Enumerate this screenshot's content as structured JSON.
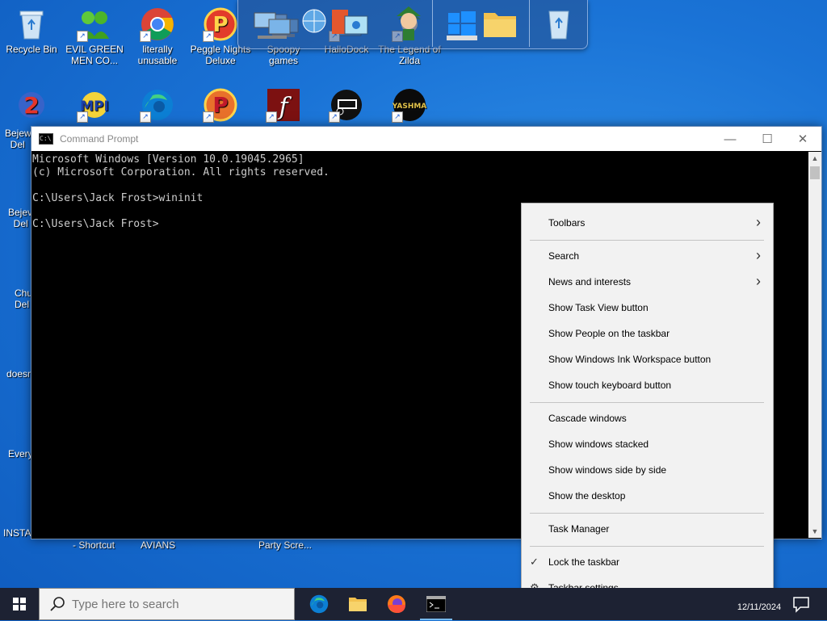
{
  "desktop": {
    "row1": [
      {
        "label": "Recycle Bin",
        "icon": "recycle-bin-icon"
      },
      {
        "label": "EVIL GREEN MEN CO...",
        "icon": "green-men-icon"
      },
      {
        "label": "literally unusable",
        "icon": "chrome-icon"
      },
      {
        "label": "Peggle Nights Deluxe",
        "icon": "peggle-icon"
      },
      {
        "label": "Spoopy games",
        "icon": "computers-icon"
      },
      {
        "label": "HalloDock",
        "icon": "hallodock-icon"
      },
      {
        "label": "The Legend of Zilda",
        "icon": "zilda-icon"
      }
    ],
    "row2": [
      "bejeweled-icon",
      "mpi-icon",
      "edge-icon",
      "peggle-icon",
      "flash-icon",
      "dark-app-icon",
      "yashma-icon"
    ],
    "yashma_text": "YASHMA",
    "left_partial": [
      {
        "label": "Bejew\nDel",
        "icon": "bejeweled-icon"
      },
      {
        "label": "Bejev\nDel",
        "icon": "bejeweled-icon"
      },
      {
        "label": "Chu\nDel",
        "icon": "chuzzle-icon"
      },
      {
        "label": "doesn",
        "icon": "app-icon"
      },
      {
        "label": "Every",
        "icon": "app-icon"
      },
      {
        "label": "INSTA",
        "icon": "document-icon"
      }
    ],
    "bottom_partial": [
      "- Shortcut",
      "AVIANS",
      "Party Scre..."
    ]
  },
  "dock": {
    "items": [
      "computers-icon",
      "globe-icon",
      "office-icon",
      "zilda-icon",
      "windows-logo-icon",
      "drive-icon",
      "folder-icon",
      "recycle-bin-icon"
    ]
  },
  "cmd": {
    "title": "Command Prompt",
    "lines": [
      "Microsoft Windows [Version 10.0.19045.2965]",
      "(c) Microsoft Corporation. All rights reserved.",
      "",
      "C:\\Users\\Jack Frost>wininit",
      "",
      "C:\\Users\\Jack Frost>"
    ],
    "minimize": "—",
    "maximize": "☐",
    "close": "✕"
  },
  "context_menu": {
    "items": [
      {
        "label": "Toolbars",
        "submenu": true
      },
      {
        "label": "Search",
        "submenu": true
      },
      {
        "label": "News and interests",
        "submenu": true
      },
      {
        "label": "Show Task View button"
      },
      {
        "label": "Show People on the taskbar"
      },
      {
        "label": "Show Windows Ink Workspace button"
      },
      {
        "label": "Show touch keyboard button"
      },
      {
        "label": "Cascade windows"
      },
      {
        "label": "Show windows stacked"
      },
      {
        "label": "Show windows side by side"
      },
      {
        "label": "Show the desktop"
      },
      {
        "label": "Task Manager"
      },
      {
        "label": "Lock the taskbar",
        "checked": true
      },
      {
        "label": "Taskbar settings",
        "icon": "gear-icon"
      }
    ]
  },
  "taskbar": {
    "search_placeholder": "Type here to search",
    "apps": [
      "edge-icon",
      "file-explorer-icon",
      "firefox-icon",
      "command-prompt-icon"
    ],
    "date": "12/11/2024"
  }
}
